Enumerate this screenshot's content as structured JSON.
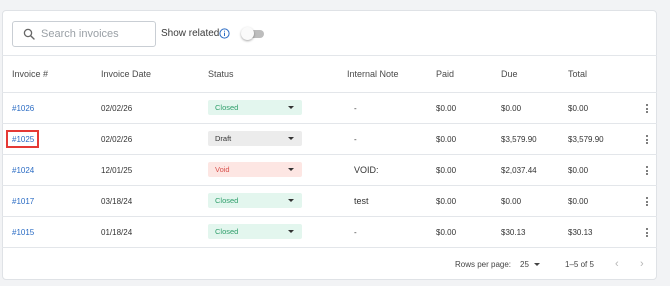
{
  "toolbar": {
    "search_placeholder": "Search invoices",
    "search_value": "",
    "show_related_label": "Show related",
    "show_related_on": false
  },
  "table": {
    "columns": [
      "Invoice #",
      "Invoice Date",
      "Status",
      "Internal Note",
      "Paid",
      "Due",
      "Total"
    ],
    "rows": [
      {
        "invoice": "#1026",
        "date": "02/02/26",
        "status": "Closed",
        "note": "-",
        "paid": "$0.00",
        "due": "$0.00",
        "total": "$0.00"
      },
      {
        "invoice": "#1025",
        "date": "02/02/26",
        "status": "Draft",
        "note": "-",
        "paid": "$0.00",
        "due": "$3,579.90",
        "total": "$3,579.90"
      },
      {
        "invoice": "#1024",
        "date": "12/01/25",
        "status": "Void",
        "note": "VOID:",
        "paid": "$0.00",
        "due": "$2,037.44",
        "total": "$0.00"
      },
      {
        "invoice": "#1017",
        "date": "03/18/24",
        "status": "Closed",
        "note": "test",
        "paid": "$0.00",
        "due": "$0.00",
        "total": "$0.00"
      },
      {
        "invoice": "#1015",
        "date": "01/18/24",
        "status": "Closed",
        "note": "-",
        "paid": "$0.00",
        "due": "$30.13",
        "total": "$30.13"
      }
    ]
  },
  "status_styles": {
    "Closed": {
      "bg": "#e3f6ee",
      "fg": "#2e9e6a"
    },
    "Draft": {
      "bg": "#ececec",
      "fg": "#333333"
    },
    "Void": {
      "bg": "#fde6e3",
      "fg": "#d9534f"
    }
  },
  "footer": {
    "rows_per_page_label": "Rows per page:",
    "rows_per_page_value": "25",
    "range_label": "1–5 of 5"
  },
  "colors": {
    "link": "#2b6cc4",
    "highlight": "#e53935",
    "info_icon": "#2b6cc4"
  }
}
